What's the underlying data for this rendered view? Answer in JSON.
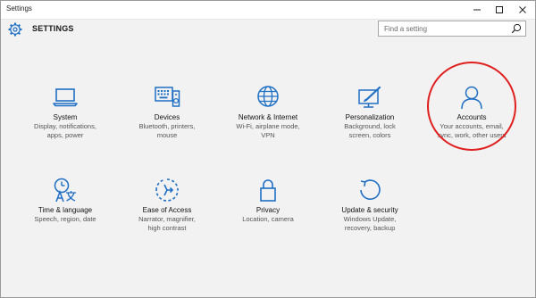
{
  "window": {
    "title": "Settings"
  },
  "header": {
    "title": "SETTINGS"
  },
  "search": {
    "placeholder": "Find a setting"
  },
  "tiles": [
    {
      "name": "System",
      "desc": [
        "Display, notifications,",
        "apps, power"
      ],
      "icon": "laptop-icon"
    },
    {
      "name": "Devices",
      "desc": [
        "Bluetooth, printers,",
        "mouse"
      ],
      "icon": "keyboard-speaker-icon"
    },
    {
      "name": "Network & Internet",
      "desc": [
        "Wi-Fi, airplane mode,",
        "VPN"
      ],
      "icon": "globe-icon"
    },
    {
      "name": "Personalization",
      "desc": [
        "Background, lock",
        "screen, colors"
      ],
      "icon": "paint-screen-icon"
    },
    {
      "name": "Accounts",
      "desc": [
        "Your accounts, email,",
        "sync, work, other users"
      ],
      "icon": "person-icon"
    },
    {
      "name": "Time & language",
      "desc": [
        "Speech, region, date"
      ],
      "icon": "clock-language-icon"
    },
    {
      "name": "Ease of Access",
      "desc": [
        "Narrator, magnifier,",
        "high contrast"
      ],
      "icon": "ease-of-access-icon"
    },
    {
      "name": "Privacy",
      "desc": [
        "Location, camera"
      ],
      "icon": "lock-icon"
    },
    {
      "name": "Update & security",
      "desc": [
        "Windows Update,",
        "recovery, backup"
      ],
      "icon": "refresh-icon"
    }
  ],
  "colors": {
    "accent": "#1f6fc5",
    "highlight": "#e01f1f"
  }
}
